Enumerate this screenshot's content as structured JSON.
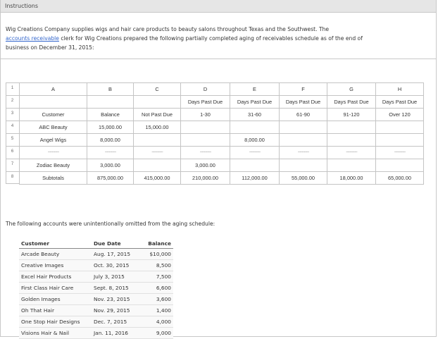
{
  "header": {
    "title": "Instructions"
  },
  "intro": {
    "p1": "Wig Creations Company supplies wigs and hair care products to beauty salons throughout Texas and the Southwest. The",
    "link": "accounts receivable",
    "p2": " clerk for Wig Creations prepared the following partially completed aging of receivables schedule as of the end of",
    "p3": "business on December 31, 2015:"
  },
  "sheet": {
    "row_numbers": [
      "1",
      "2",
      "3",
      "4",
      "5",
      "6",
      "7",
      "8"
    ],
    "col_letters": [
      "A",
      "B",
      "C",
      "D",
      "E",
      "F",
      "G",
      "H"
    ],
    "header_row2": [
      "",
      "",
      "",
      "Days Past Due",
      "Days Past Due",
      "Days Past Due",
      "Days Past Due",
      "Days Past Due"
    ],
    "header_row3": [
      "Customer",
      "Balance",
      "Not Past Due",
      "1-30",
      "31-60",
      "61-90",
      "91-120",
      "Over 120"
    ],
    "rows": [
      [
        "ABC Beauty",
        "15,000.00",
        "15,000.00",
        "",
        "",
        "",
        "",
        ""
      ],
      [
        "Angel Wigs",
        "8,000.00",
        "",
        "",
        "8,000.00",
        "",
        "",
        ""
      ],
      [
        "~~~~~",
        "~~~~~",
        "~~~~~",
        "~~~~~",
        "~~~~~",
        "~~~~~",
        "~~~~~",
        "~~~~~"
      ],
      [
        "Zodiac Beauty",
        "3,000.00",
        "",
        "3,000.00",
        "",
        "",
        "",
        ""
      ],
      [
        "Subtotals",
        "875,000.00",
        "415,000.00",
        "210,000.00",
        "112,000.00",
        "55,000.00",
        "18,000.00",
        "65,000.00"
      ]
    ]
  },
  "omitted": {
    "text": "The following accounts were unintentionally omitted from the aging schedule:",
    "headers": [
      "Customer",
      "Due Date",
      "Balance"
    ],
    "rows": [
      [
        "Arcade Beauty",
        "Aug. 17, 2015",
        "$10,000"
      ],
      [
        "Creative Images",
        "Oct. 30, 2015",
        "8,500"
      ],
      [
        "Excel Hair Products",
        "July 3, 2015",
        "7,500"
      ],
      [
        "First Class Hair Care",
        "Sept. 8, 2015",
        "6,600"
      ],
      [
        "Golden Images",
        "Nov. 23, 2015",
        "3,600"
      ],
      [
        "Oh That Hair",
        "Nov. 29, 2015",
        "1,400"
      ],
      [
        "One Stop Hair Designs",
        "Dec. 7, 2015",
        "4,000"
      ],
      [
        "Visions Hair & Nail",
        "Jan. 11, 2016",
        "9,000"
      ]
    ]
  }
}
